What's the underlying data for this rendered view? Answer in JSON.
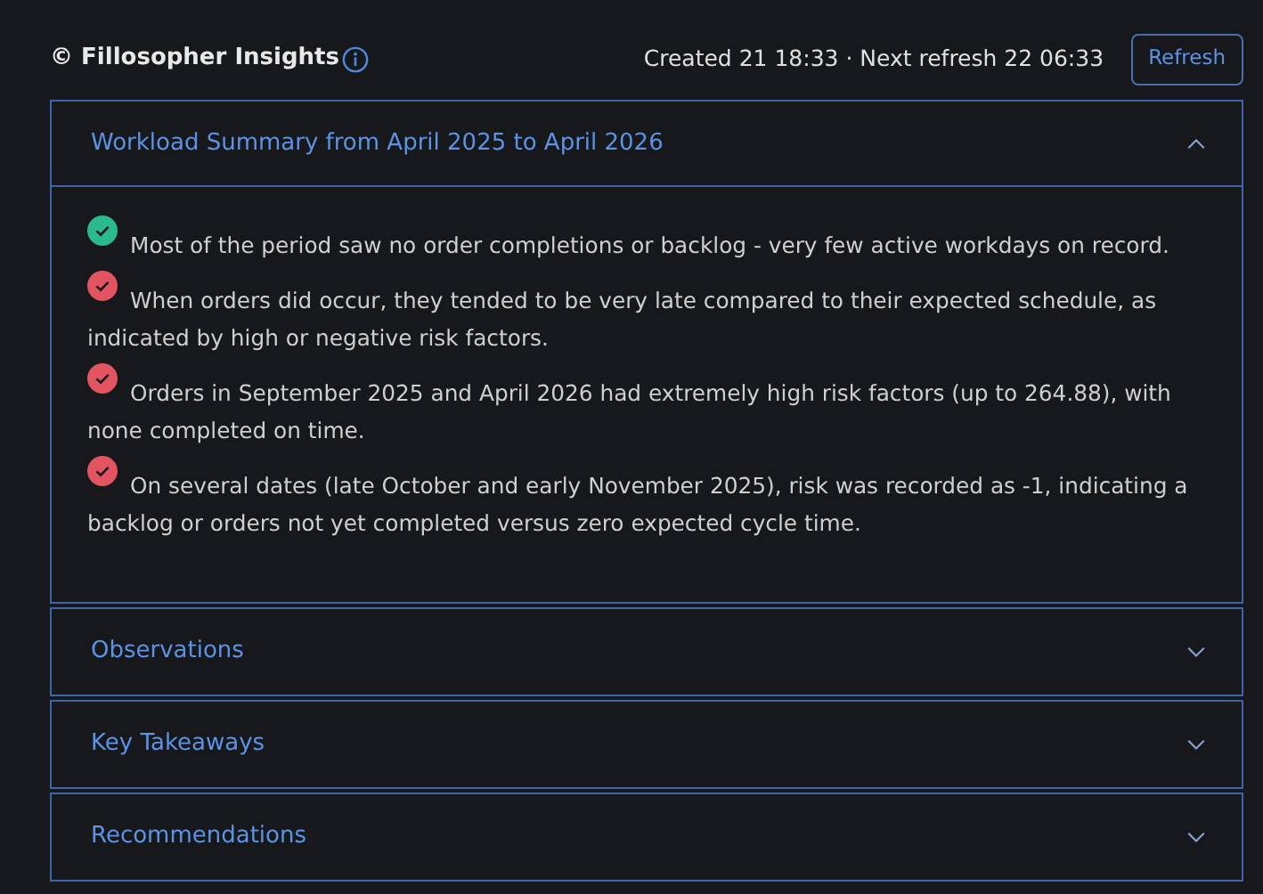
{
  "header": {
    "title": "© Fillosopher Insights",
    "meta": "Created 21 18:33 · Next refresh 22 06:33",
    "refresh_button": "Refresh"
  },
  "sections": [
    {
      "title": "Workload Summary from April 2025 to April 2026",
      "expanded": true,
      "items": [
        {
          "color": "#2bb98e",
          "text": "Most of the period saw no order completions or backlog - very few active workdays on record."
        },
        {
          "color": "#e2545f",
          "text": "When orders did occur, they tended to be very late compared to their expected schedule, as indicated by high or negative risk factors."
        },
        {
          "color": "#e2545f",
          "text": "Orders in September 2025 and April 2026 had extremely high risk factors (up to 264.88), with none completed on time."
        },
        {
          "color": "#e2545f",
          "text": "On several dates (late October and early November 2025), risk was recorded as -1, indicating a backlog or orders not yet completed versus zero expected cycle time."
        }
      ]
    },
    {
      "title": "Observations",
      "expanded": false
    },
    {
      "title": "Key Takeaways",
      "expanded": false
    },
    {
      "title": "Recommendations",
      "expanded": false
    }
  ]
}
